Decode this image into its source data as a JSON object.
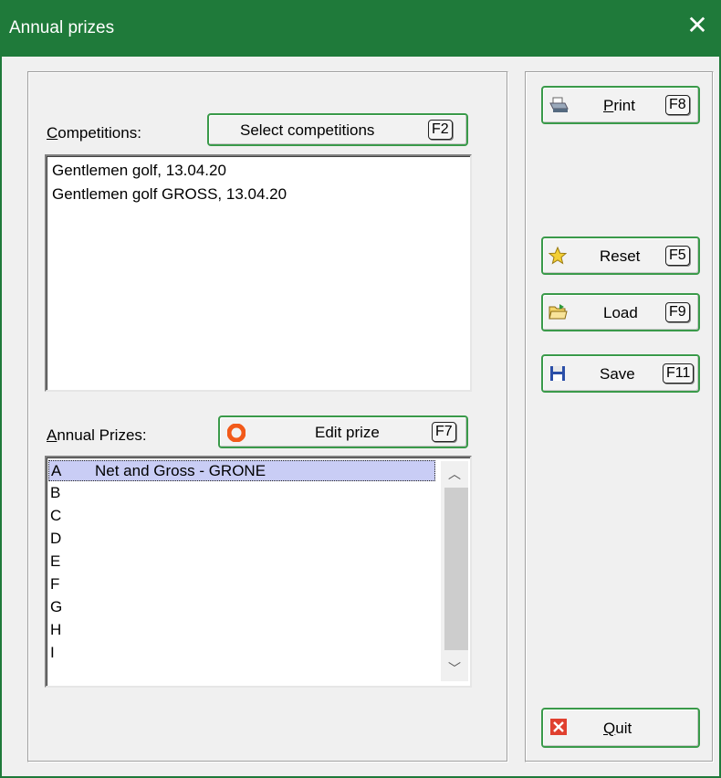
{
  "window": {
    "title": "Annual prizes"
  },
  "competitions": {
    "label_prefix": "C",
    "label_rest": "ompetitions:",
    "select_button": {
      "label": "Select competitions",
      "key": "F2"
    },
    "items": [
      "Gentlemen golf, 13.04.20",
      "Gentlemen golf GROSS, 13.04.20"
    ]
  },
  "annual_prizes": {
    "label_prefix": "A",
    "label_rest": "nnual Prizes:",
    "edit_button": {
      "label": "Edit prize",
      "key": "F7"
    },
    "rows": [
      {
        "letter": "A",
        "name": "Net and Gross - GRONE",
        "selected": true
      },
      {
        "letter": "B",
        "name": ""
      },
      {
        "letter": "C",
        "name": ""
      },
      {
        "letter": "D",
        "name": ""
      },
      {
        "letter": "E",
        "name": ""
      },
      {
        "letter": "F",
        "name": ""
      },
      {
        "letter": "G",
        "name": ""
      },
      {
        "letter": "H",
        "name": ""
      },
      {
        "letter": "I",
        "name": ""
      }
    ]
  },
  "actions": {
    "print": {
      "label_prefix": "P",
      "label_rest": "rint",
      "key": "F8",
      "icon": "printer-icon"
    },
    "reset": {
      "label": "Reset",
      "key": "F5",
      "icon": "star-icon"
    },
    "load": {
      "label": "Load",
      "key": "F9",
      "icon": "folder-open-icon"
    },
    "save": {
      "label": "Save",
      "key": "F11",
      "icon": "floppy-disk-icon"
    },
    "quit": {
      "label_prefix": "Q",
      "label_rest": "uit",
      "icon": "close-red-icon"
    }
  },
  "colors": {
    "titlebar": "#1f7a3a",
    "button_border": "#3a9a4a",
    "selection": "#c9cdf5"
  }
}
